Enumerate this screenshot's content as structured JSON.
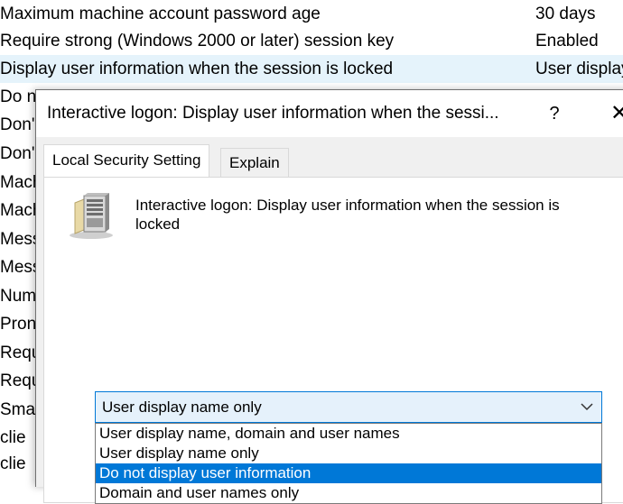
{
  "policy_list": {
    "rows": [
      {
        "name": "Maximum machine account password age",
        "value": "30 days"
      },
      {
        "name": "Require strong (Windows 2000 or later) session key",
        "value": "Enabled"
      },
      {
        "name": "Display user information when the session is locked",
        "value": "User display"
      },
      {
        "name": "Do n",
        "value": ""
      },
      {
        "name": "Don'",
        "value": ""
      },
      {
        "name": "Don'",
        "value": ""
      },
      {
        "name": "Mach",
        "value": ""
      },
      {
        "name": "Mach",
        "value": ""
      },
      {
        "name": "Mess",
        "value": ""
      },
      {
        "name": "Mess",
        "value": ""
      },
      {
        "name": "Num",
        "value": ""
      },
      {
        "name": "Pron",
        "value": ""
      },
      {
        "name": "Requ",
        "value": ""
      },
      {
        "name": "Requ",
        "value": ""
      },
      {
        "name": "Sma",
        "value": ""
      },
      {
        "name": " clie",
        "value": ""
      },
      {
        "name": " clie",
        "value": ""
      }
    ]
  },
  "dialog": {
    "title": "Interactive logon: Display user information when the sessi...",
    "help_label": "?",
    "close_label": "✕",
    "tabs": [
      {
        "label": "Local Security Setting",
        "active": true
      },
      {
        "label": "Explain",
        "active": false
      }
    ],
    "policy_title": "Interactive logon: Display user information when the session is locked",
    "icon": "server-icon",
    "combo": {
      "selected": "User display name only",
      "options": [
        "User display name, domain and user names",
        "User display name only",
        "Do not display user information",
        "Domain and user names only"
      ],
      "highlighted_index": 2
    }
  },
  "colors": {
    "selected_row": "#e5f3fb",
    "combo_bg": "#e5f1fb",
    "accent": "#0078d7"
  }
}
